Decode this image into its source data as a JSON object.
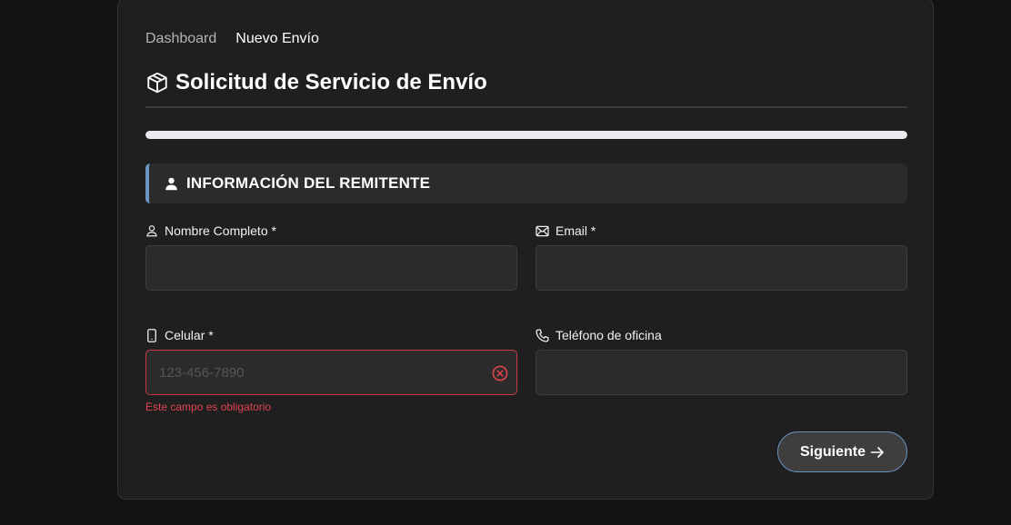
{
  "breadcrumb": {
    "items": [
      "Dashboard",
      "Nuevo Envío"
    ]
  },
  "header": {
    "title": "Solicitud de Servicio de Envío",
    "icon": "package-icon"
  },
  "progress": {
    "fraction": 1.0
  },
  "section": {
    "title": "INFORMACIÓN DEL REMITENTE",
    "icon": "user-icon",
    "accent_color": "#6b93bf"
  },
  "fields": {
    "full_name": {
      "label": "Nombre Completo *",
      "value": "",
      "placeholder": "",
      "icon": "user-outline-icon"
    },
    "email": {
      "label": "Email *",
      "value": "",
      "placeholder": "",
      "icon": "envelope-icon"
    },
    "mobile": {
      "label": "Celular *",
      "value": "",
      "placeholder": "123-456-7890",
      "icon": "mobile-phone-icon",
      "error": "Este campo es obligatorio",
      "error_color": "#e0434f"
    },
    "office_phone": {
      "label": "Teléfono de oficina",
      "value": "",
      "placeholder": "",
      "icon": "phone-icon"
    }
  },
  "actions": {
    "next_label": "Siguiente",
    "next_icon": "arrow-right-icon"
  }
}
